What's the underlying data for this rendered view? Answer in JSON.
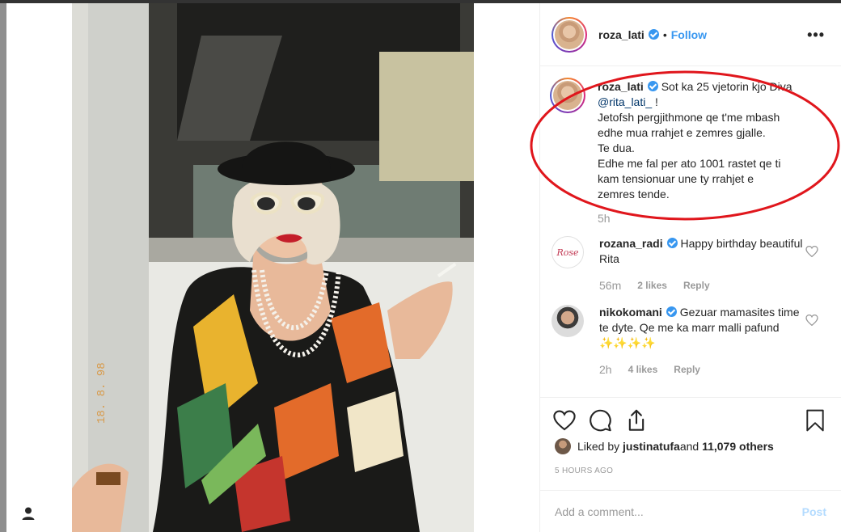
{
  "post": {
    "username": "roza_lati",
    "follow_label": "Follow",
    "separator": "•",
    "more_label": "•••"
  },
  "caption": {
    "username": "roza_lati",
    "text_1": "Sot ka 25 vjetorin kjo Diva",
    "mention": "@rita_lati_",
    "text_2": " !",
    "lines": [
      "Jetofsh pergjithmone qe t'me mbash",
      "edhe mua rrahjet e zemres gjalle.",
      "Te dua.",
      "Edhe me fal per ato 1001 rastet qe ti",
      "kam tensionuar une ty rrahjet e",
      "zemres tende."
    ],
    "time": "5h"
  },
  "comments": [
    {
      "username": "rozana_radi",
      "text": "Happy birthday beautiful Rita",
      "time": "56m",
      "likes": "2 likes",
      "reply": "Reply",
      "avatar_text": "Rose"
    },
    {
      "username": "nikokomani",
      "text": "Gezuar mamasites time te dyte. Qe me ka marr malli pafund ✨✨✨✨",
      "time": "2h",
      "likes": "4 likes",
      "reply": "Reply"
    }
  ],
  "likes": {
    "prefix": "Liked by ",
    "user": "justinatufa",
    "middle": " and ",
    "count": "11,079 others"
  },
  "timestamp": "5 HOURS AGO",
  "add_comment_placeholder": "Add a comment...",
  "post_button": "Post",
  "photo_date_stamp": "18. 8. 98",
  "icons": [
    "heart-icon",
    "comment-icon",
    "share-icon",
    "bookmark-icon",
    "verified-icon",
    "more-icon",
    "user-icon"
  ],
  "colors": {
    "accent": "#3897f0",
    "annotation": "#e0161c"
  }
}
